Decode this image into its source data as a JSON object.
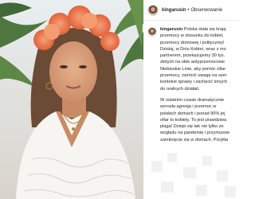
{
  "post": {
    "username": "kingarusin",
    "follow_label": "Obserwowanie",
    "separator": "•"
  },
  "caption": {
    "username": "kingarusin",
    "paragraph1": [
      "Polska stała się krają",
      "przemocy w stosunku do kobiet,",
      "przemocy domowej i politycznej!",
      "Dzisiaj, w Dniu Kobiet, wraz z mo",
      "partnerem, przekazujemy 30 tys.",
      "złotych na obie antyprzemocowe",
      "Niebieskie Linie, aby pomóc ofiar",
      "przemocy, zwrócić uwagę na szer",
      "kontekst sprawy i zachęcić innych",
      "do realnych działań."
    ],
    "paragraph2": [
      "W ostatnim czasie dramatycznie",
      "wzrosła agresja i przemoc w",
      "polskich domach i ponad 90% jej",
      "ofiar to kobiety. To jest prawdziwa",
      "plaga! Dzieje się tak nie tylko ze",
      "względu na pandemię i przymusow",
      "zamknięcie się w domach. Przykła"
    ]
  },
  "colors": {
    "flower_orange": "#f07a4a",
    "hair_brown": "#6b4a36",
    "dress_white": "#f7f5f2",
    "palm_green": "#3e6b2e"
  }
}
